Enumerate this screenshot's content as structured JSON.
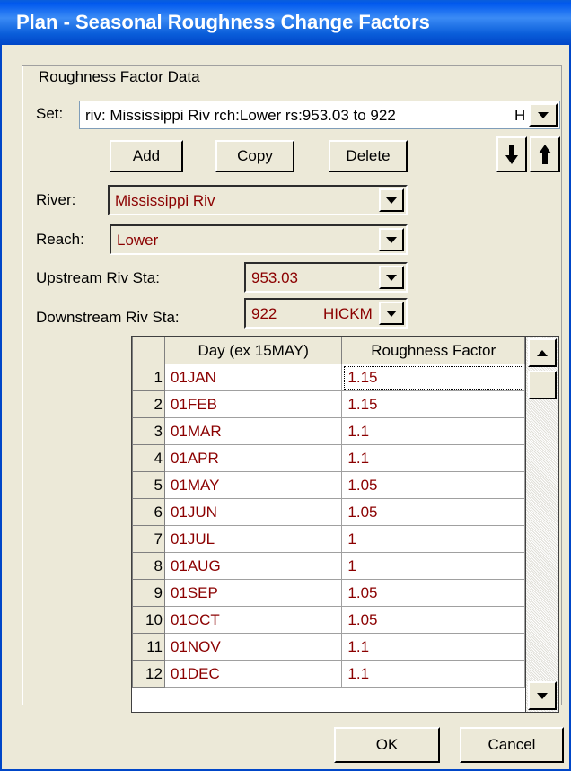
{
  "window": {
    "title": "Plan - Seasonal Roughness Change Factors"
  },
  "group": {
    "label": "Roughness Factor Data"
  },
  "set": {
    "label": "Set:",
    "value": "riv: Mississippi Riv rch:Lower rs:953.03  to 922",
    "value_suffix": "H"
  },
  "buttons": {
    "add": "Add",
    "copy": "Copy",
    "delete": "Delete",
    "ok": "OK",
    "cancel": "Cancel"
  },
  "river": {
    "label": "River:",
    "value": "Mississippi Riv"
  },
  "reach": {
    "label": "Reach:",
    "value": "Lower"
  },
  "upstream": {
    "label": "Upstream Riv Sta:",
    "value": "953.03"
  },
  "downstream": {
    "label": "Downstream Riv Sta:",
    "value": "922",
    "value_suffix": "HICKM"
  },
  "table": {
    "headers": {
      "day": "Day (ex 15MAY)",
      "factor": "Roughness Factor"
    },
    "rows": [
      {
        "num": "1",
        "day": "01JAN",
        "factor": "1.15"
      },
      {
        "num": "2",
        "day": "01FEB",
        "factor": "1.15"
      },
      {
        "num": "3",
        "day": "01MAR",
        "factor": "1.1"
      },
      {
        "num": "4",
        "day": "01APR",
        "factor": "1.1"
      },
      {
        "num": "5",
        "day": "01MAY",
        "factor": "1.05"
      },
      {
        "num": "6",
        "day": "01JUN",
        "factor": "1.05"
      },
      {
        "num": "7",
        "day": "01JUL",
        "factor": "1"
      },
      {
        "num": "8",
        "day": "01AUG",
        "factor": "1"
      },
      {
        "num": "9",
        "day": "01SEP",
        "factor": "1.05"
      },
      {
        "num": "10",
        "day": "01OCT",
        "factor": "1.05"
      },
      {
        "num": "11",
        "day": "01NOV",
        "factor": "1.1"
      },
      {
        "num": "12",
        "day": "01DEC",
        "factor": "1.1"
      }
    ]
  },
  "icons": {
    "move_down": "arrow-down-icon",
    "move_up": "arrow-up-icon",
    "dropdown": "triangle-down-icon"
  },
  "colors": {
    "title_bar": "#0A5EDA",
    "data_text": "#8B0000",
    "window_bg": "#ECE9D8"
  }
}
